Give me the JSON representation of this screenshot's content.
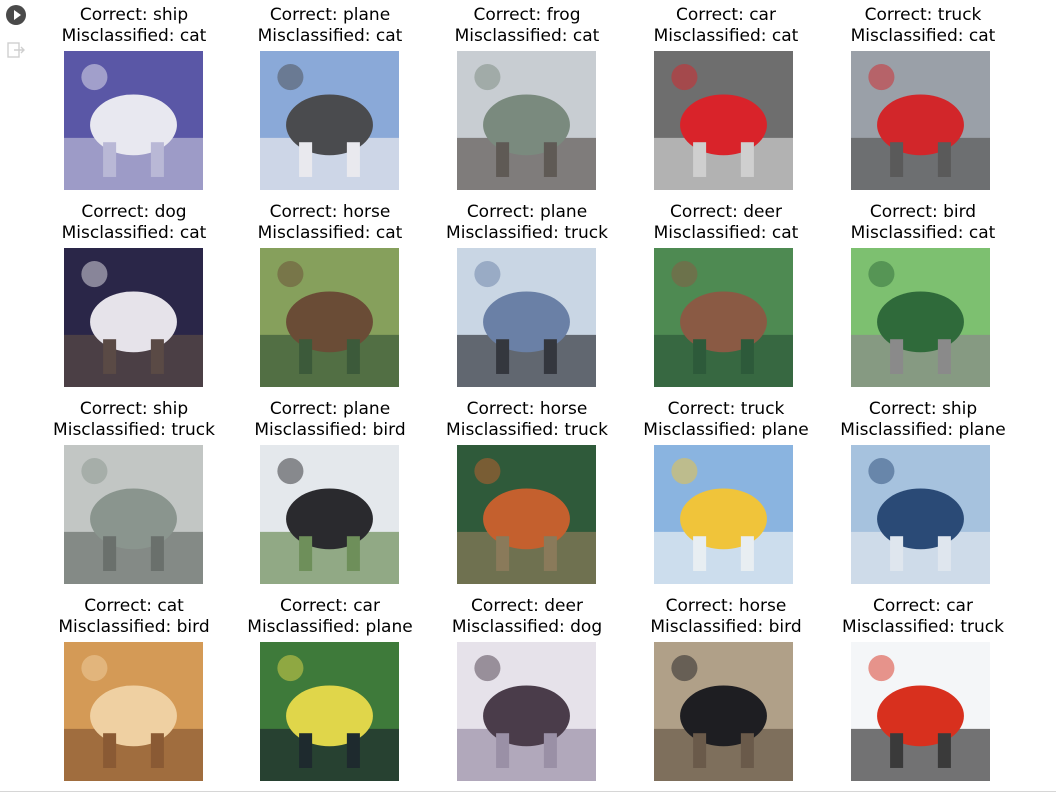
{
  "notebook": {
    "run_button_label": "run cell",
    "output_icon": "output-collapse-icon"
  },
  "labels": {
    "correct_prefix": "Correct: ",
    "mis_prefix": "Misclassified: "
  },
  "items": [
    {
      "correct": "ship",
      "mis": "cat",
      "scene": "cat-white",
      "c": [
        "#5a57a6",
        "#e8e8f0",
        "#b9b8d6"
      ]
    },
    {
      "correct": "plane",
      "mis": "cat",
      "scene": "plane-ground",
      "c": [
        "#8aa9d8",
        "#4a4b4e",
        "#e9e9ee"
      ]
    },
    {
      "correct": "frog",
      "mis": "cat",
      "scene": "frog",
      "c": [
        "#c8cdd2",
        "#7a8a7e",
        "#5f5a55"
      ]
    },
    {
      "correct": "car",
      "mis": "cat",
      "scene": "car-red",
      "c": [
        "#6e6e6e",
        "#d9232a",
        "#cfcfcf"
      ]
    },
    {
      "correct": "truck",
      "mis": "cat",
      "scene": "truck-red",
      "c": [
        "#9aa0a8",
        "#d2262a",
        "#5a5a5a"
      ]
    },
    {
      "correct": "dog",
      "mis": "cat",
      "scene": "dog",
      "c": [
        "#2a2648",
        "#e6e3ea",
        "#5a4a45"
      ]
    },
    {
      "correct": "horse",
      "mis": "cat",
      "scene": "horse-field",
      "c": [
        "#86a05c",
        "#6a4c36",
        "#3c5a3a"
      ]
    },
    {
      "correct": "plane",
      "mis": "truck",
      "scene": "plane-tail",
      "c": [
        "#c9d6e4",
        "#6a80a6",
        "#34373e"
      ]
    },
    {
      "correct": "deer",
      "mis": "cat",
      "scene": "deer",
      "c": [
        "#4e8a52",
        "#8a5a44",
        "#2d5a3a"
      ]
    },
    {
      "correct": "bird",
      "mis": "cat",
      "scene": "bird-park",
      "c": [
        "#7dc070",
        "#2f6a3a",
        "#8a8a8a"
      ]
    },
    {
      "correct": "ship",
      "mis": "truck",
      "scene": "sail",
      "c": [
        "#c2c6c4",
        "#8a958e",
        "#6a706c"
      ]
    },
    {
      "correct": "plane",
      "mis": "bird",
      "scene": "plane-sky",
      "c": [
        "#e4e8ec",
        "#2a2a2e",
        "#6e8f5a"
      ]
    },
    {
      "correct": "horse",
      "mis": "truck",
      "scene": "horse-brown",
      "c": [
        "#2f5a3a",
        "#c4602e",
        "#8a7a5a"
      ]
    },
    {
      "correct": "truck",
      "mis": "plane",
      "scene": "truck-yellow",
      "c": [
        "#8ab4e0",
        "#f0c43a",
        "#e8eef2"
      ]
    },
    {
      "correct": "ship",
      "mis": "plane",
      "scene": "ship-sea",
      "c": [
        "#a6c2de",
        "#2a4a76",
        "#dfe6ee"
      ]
    },
    {
      "correct": "cat",
      "mis": "bird",
      "scene": "cat-orange",
      "c": [
        "#d49a56",
        "#efd0a2",
        "#8a5a34"
      ]
    },
    {
      "correct": "car",
      "mis": "plane",
      "scene": "car-yellow",
      "c": [
        "#3e7a3a",
        "#e0d64a",
        "#1e2a2e"
      ]
    },
    {
      "correct": "deer",
      "mis": "dog",
      "scene": "deer-snow",
      "c": [
        "#e6e2ea",
        "#4a3c4a",
        "#9a90a6"
      ]
    },
    {
      "correct": "horse",
      "mis": "bird",
      "scene": "rider",
      "c": [
        "#b0a088",
        "#1e1e22",
        "#6a5a4a"
      ]
    },
    {
      "correct": "car",
      "mis": "truck",
      "scene": "car-white-bg",
      "c": [
        "#f4f6f8",
        "#d8301e",
        "#3a3a3a"
      ]
    }
  ]
}
